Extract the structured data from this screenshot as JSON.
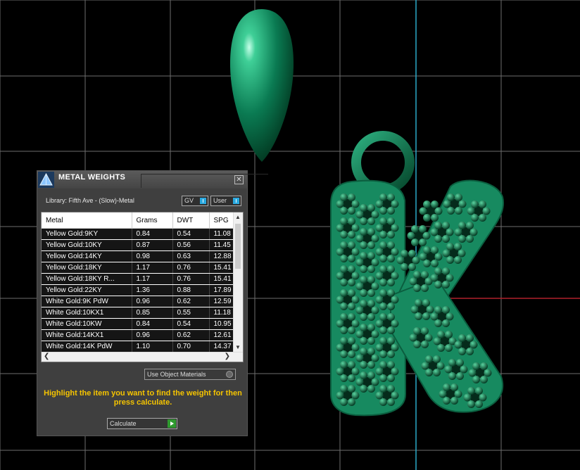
{
  "panel": {
    "title": "METAL WEIGHTS",
    "library_label": "Library: Fifth Ave - (Slow)-Metal",
    "toggle_gv": "GV",
    "toggle_user": "User",
    "columns": [
      "Metal",
      "Grams",
      "DWT",
      "SPG"
    ],
    "rows": [
      [
        "Yellow Gold:9KY",
        "0.84",
        "0.54",
        "11.08"
      ],
      [
        "Yellow Gold:10KY",
        "0.87",
        "0.56",
        "11.45"
      ],
      [
        "Yellow Gold:14KY",
        "0.98",
        "0.63",
        "12.88"
      ],
      [
        "Yellow Gold:18KY",
        "1.17",
        "0.76",
        "15.41"
      ],
      [
        "Yellow Gold:18KY R...",
        "1.17",
        "0.76",
        "15.41"
      ],
      [
        "Yellow Gold:22KY",
        "1.36",
        "0.88",
        "17.89"
      ],
      [
        "White Gold:9K PdW",
        "0.96",
        "0.62",
        "12.59"
      ],
      [
        "White Gold:10KX1",
        "0.85",
        "0.55",
        "11.18"
      ],
      [
        "White Gold:10KW",
        "0.84",
        "0.54",
        "10.95"
      ],
      [
        "White Gold:14KX1",
        "0.96",
        "0.62",
        "12.61"
      ],
      [
        "White Gold:14K PdW",
        "1.10",
        "0.70",
        "14.37"
      ]
    ],
    "use_object_materials": "Use Object Materials",
    "hint": "Highlight the item you want to find the weight for then press calculate.",
    "calculate": "Calculate",
    "close_icon": "close-icon",
    "app_icon": "pyramid-icon"
  },
  "colors": {
    "background": "#000000",
    "grid": "#6e6e6e",
    "axis_blue": "#2aa9c8",
    "axis_red": "#b0202a",
    "model_green": "#0d7a55",
    "hint_yellow": "#f5c400"
  }
}
